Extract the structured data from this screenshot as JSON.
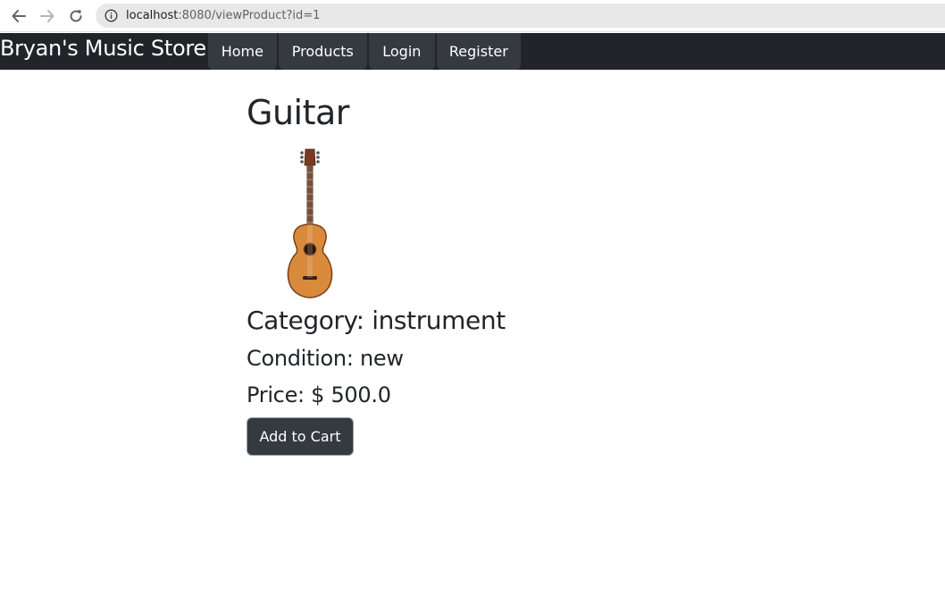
{
  "browser": {
    "url_host": "localhost",
    "url_rest": ":8080/viewProduct?id=1"
  },
  "navbar": {
    "brand": "Bryan's Music Store",
    "items": [
      {
        "label": "Home"
      },
      {
        "label": "Products"
      },
      {
        "label": "Login"
      },
      {
        "label": "Register"
      }
    ]
  },
  "product": {
    "name": "Guitar",
    "category": "Category: instrument",
    "condition": "Condition: new",
    "price": "Price: $ 500.0",
    "add_to_cart_label": "Add to Cart",
    "image_icon": "acoustic-guitar-image"
  },
  "colors": {
    "navbar_bg": "#212529",
    "nav_item_bg": "#343a40",
    "button_bg": "#343a40",
    "text": "#212529"
  }
}
